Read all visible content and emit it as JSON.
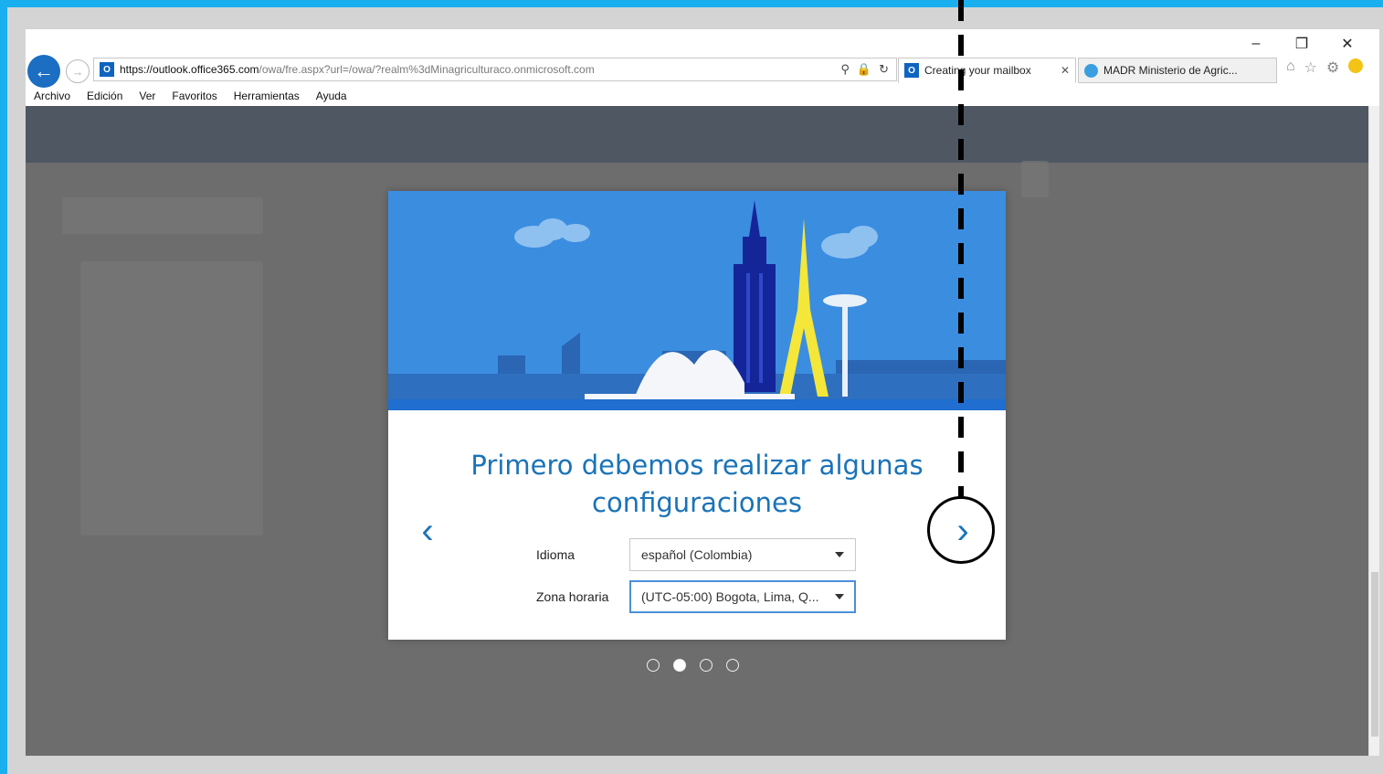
{
  "browser": {
    "url_prefix": "https://outlook.",
    "url_domain": "office365.com",
    "url_rest": "/owa/fre.aspx?url=/owa/?realm%3dMinagriculturaco.onmicrosoft.com",
    "tabs": [
      {
        "label": "Creating your mailbox",
        "active": true
      },
      {
        "label": "MADR Ministerio de Agric...",
        "active": false
      }
    ],
    "window_controls": {
      "minimize": "–",
      "restore": "❐",
      "close": "✕"
    }
  },
  "menu": {
    "items": [
      "Archivo",
      "Edición",
      "Ver",
      "Favoritos",
      "Herramientas",
      "Ayuda"
    ]
  },
  "dialog": {
    "title": "Primero debemos realizar algunas configuraciones",
    "language_label": "Idioma",
    "language_value": "español (Colombia)",
    "timezone_label": "Zona horaria",
    "timezone_value": "(UTC-05:00) Bogota, Lima, Q...",
    "prev_arrow": "‹",
    "next_arrow": "›"
  },
  "pagination": {
    "total": 4,
    "current": 2
  },
  "colors": {
    "frame": "#1ab0f0",
    "accent": "#1a73b8",
    "hero_sky": "#3b8de0",
    "overlay": "#6d6d6d"
  }
}
